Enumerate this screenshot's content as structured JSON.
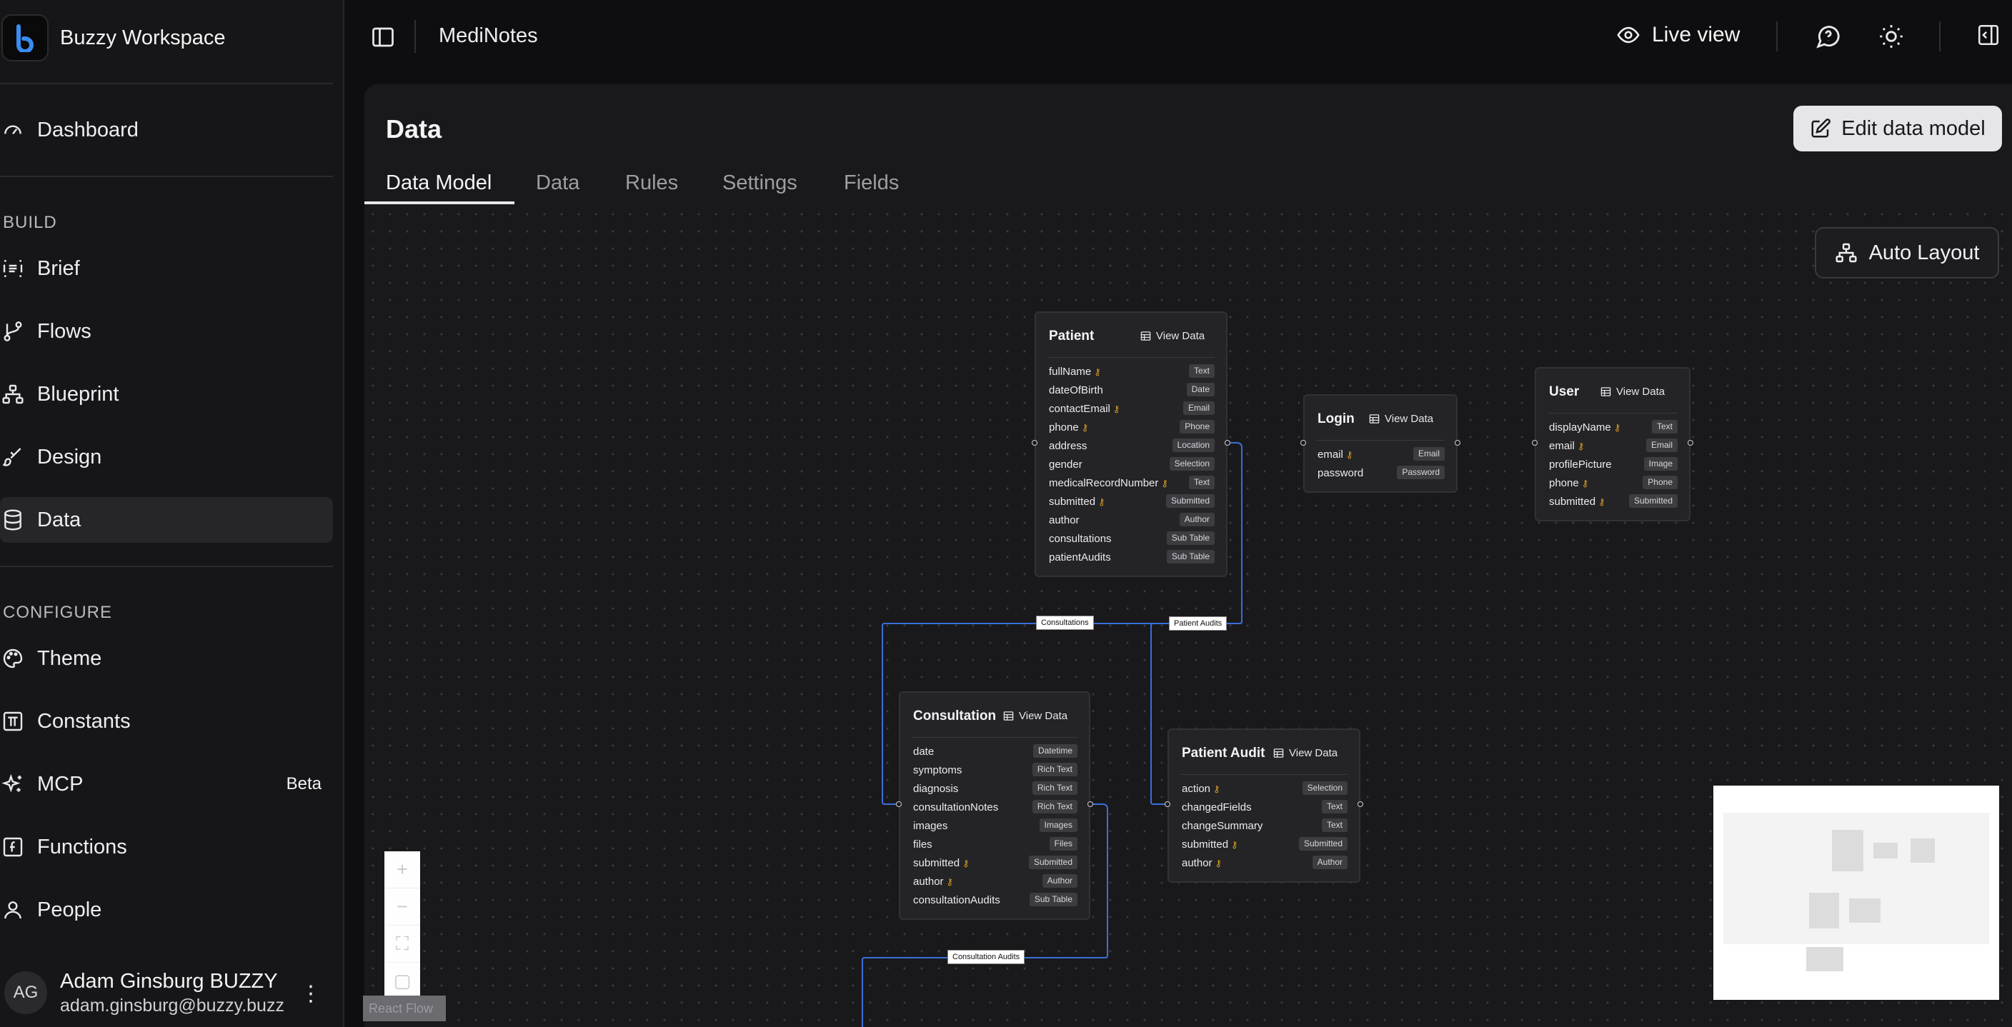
{
  "workspace": {
    "name": "Buzzy Workspace",
    "logo_letter": "b"
  },
  "sidebar": {
    "dashboard": "Dashboard",
    "build_label": "BUILD",
    "build_items": [
      "Brief",
      "Flows",
      "Blueprint",
      "Design",
      "Data"
    ],
    "configure_label": "CONFIGURE",
    "configure_items": [
      "Theme",
      "Constants",
      "MCP",
      "Functions",
      "People"
    ],
    "mcp_badge": "Beta",
    "active_item": "Data",
    "user": {
      "initials": "AG",
      "name": "Adam Ginsburg BUZZY",
      "email": "adam.ginsburg@buzzy.buzz"
    }
  },
  "topbar": {
    "app_name": "MediNotes",
    "live_view": "Live view"
  },
  "page": {
    "title": "Data",
    "edit_button": "Edit data model",
    "tabs": [
      "Data Model",
      "Data",
      "Rules",
      "Settings",
      "Fields"
    ],
    "active_tab": "Data Model",
    "auto_layout": "Auto Layout"
  },
  "view_data_label": "View Data",
  "tables": {
    "patient": {
      "name": "Patient",
      "fields": [
        {
          "name": "fullName",
          "type": "Text",
          "key": true
        },
        {
          "name": "dateOfBirth",
          "type": "Date",
          "key": false
        },
        {
          "name": "contactEmail",
          "type": "Email",
          "key": true
        },
        {
          "name": "phone",
          "type": "Phone",
          "key": true
        },
        {
          "name": "address",
          "type": "Location",
          "key": false
        },
        {
          "name": "gender",
          "type": "Selection",
          "key": false
        },
        {
          "name": "medicalRecordNumber",
          "type": "Text",
          "key": true
        },
        {
          "name": "submitted",
          "type": "Submitted",
          "key": true
        },
        {
          "name": "author",
          "type": "Author",
          "key": false
        },
        {
          "name": "consultations",
          "type": "Sub Table",
          "key": false
        },
        {
          "name": "patientAudits",
          "type": "Sub Table",
          "key": false
        }
      ]
    },
    "login": {
      "name": "Login",
      "fields": [
        {
          "name": "email",
          "type": "Email",
          "key": true
        },
        {
          "name": "password",
          "type": "Password",
          "key": false
        }
      ]
    },
    "user": {
      "name": "User",
      "fields": [
        {
          "name": "displayName",
          "type": "Text",
          "key": true
        },
        {
          "name": "email",
          "type": "Email",
          "key": true
        },
        {
          "name": "profilePicture",
          "type": "Image",
          "key": false
        },
        {
          "name": "phone",
          "type": "Phone",
          "key": true
        },
        {
          "name": "submitted",
          "type": "Submitted",
          "key": true
        }
      ]
    },
    "consultation": {
      "name": "Consultation",
      "fields": [
        {
          "name": "date",
          "type": "Datetime",
          "key": false
        },
        {
          "name": "symptoms",
          "type": "Rich Text",
          "key": false
        },
        {
          "name": "diagnosis",
          "type": "Rich Text",
          "key": false
        },
        {
          "name": "consultationNotes",
          "type": "Rich Text",
          "key": false
        },
        {
          "name": "images",
          "type": "Images",
          "key": false
        },
        {
          "name": "files",
          "type": "Files",
          "key": false
        },
        {
          "name": "submitted",
          "type": "Submitted",
          "key": true
        },
        {
          "name": "author",
          "type": "Author",
          "key": true
        },
        {
          "name": "consultationAudits",
          "type": "Sub Table",
          "key": false
        }
      ]
    },
    "patient_audit": {
      "name": "Patient Audit",
      "fields": [
        {
          "name": "action",
          "type": "Selection",
          "key": true
        },
        {
          "name": "changedFields",
          "type": "Text",
          "key": false
        },
        {
          "name": "changeSummary",
          "type": "Text",
          "key": false
        },
        {
          "name": "submitted",
          "type": "Submitted",
          "key": true
        },
        {
          "name": "author",
          "type": "Author",
          "key": true
        }
      ]
    }
  },
  "edges": {
    "consultations": "Consultations",
    "patient_audits": "Patient Audits",
    "consultation_audits": "Consultation Audits"
  },
  "flow": {
    "attribution": "React Flow"
  },
  "colors": {
    "edge": "#3a6fd8",
    "key_icon": "#e0a020",
    "accent": "#3b8cf0"
  }
}
